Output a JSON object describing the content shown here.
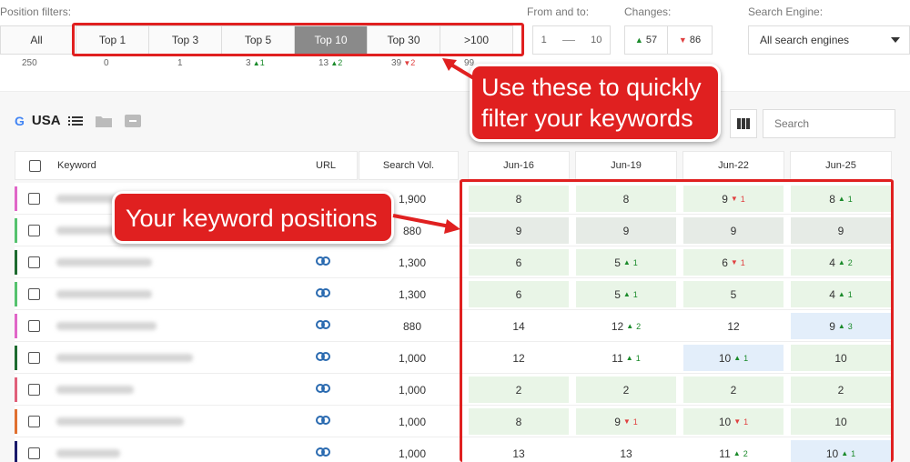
{
  "filters": {
    "position_label": "Position filters:",
    "all_label": "All",
    "buttons": [
      "Top 1",
      "Top 3",
      "Top 5",
      "Top 10",
      "Top 30",
      ">100"
    ],
    "active": "Top 10",
    "counts": [
      {
        "value": "250"
      },
      {
        "value": "0"
      },
      {
        "value": "1"
      },
      {
        "value": "3",
        "delta": "1",
        "dir": "up"
      },
      {
        "value": "13",
        "delta": "2",
        "dir": "up"
      },
      {
        "value": "39",
        "delta": "2",
        "dir": "down"
      },
      {
        "value": "99"
      }
    ],
    "from_to_label": "From and to:",
    "from_value": "1",
    "to_value": "10",
    "changes_label": "Changes:",
    "changes_up": "57",
    "changes_down": "86",
    "engine_label": "Search Engine:",
    "engine_value": "All search engines"
  },
  "panel": {
    "country": "USA",
    "search_placeholder": "Search"
  },
  "table": {
    "headers": {
      "keyword": "Keyword",
      "url": "URL",
      "volume": "Search Vol."
    },
    "dates": [
      "Jun-16",
      "Jun-19",
      "Jun-22",
      "Jun-25"
    ],
    "rows": [
      {
        "bar": "#e066c8",
        "link": false,
        "volume": "1,900",
        "kwlen": 80,
        "pos": [
          {
            "v": "8",
            "bg": "green"
          },
          {
            "v": "8",
            "bg": "green"
          },
          {
            "v": "9",
            "d": "1",
            "dir": "down",
            "bg": "green"
          },
          {
            "v": "8",
            "d": "1",
            "dir": "up",
            "bg": "green"
          }
        ]
      },
      {
        "bar": "#55c26e",
        "link": false,
        "volume": "880",
        "kwlen": 70,
        "pos": [
          {
            "v": "9",
            "bg": "grey"
          },
          {
            "v": "9",
            "bg": "grey"
          },
          {
            "v": "9",
            "bg": "grey"
          },
          {
            "v": "9",
            "bg": "grey"
          }
        ]
      },
      {
        "bar": "#1e6b30",
        "link": true,
        "volume": "1,300",
        "kwlen": 105,
        "pos": [
          {
            "v": "6",
            "bg": "green"
          },
          {
            "v": "5",
            "d": "1",
            "dir": "up",
            "bg": "green"
          },
          {
            "v": "6",
            "d": "1",
            "dir": "down",
            "bg": "green"
          },
          {
            "v": "4",
            "d": "2",
            "dir": "up",
            "bg": "green"
          }
        ]
      },
      {
        "bar": "#55c26e",
        "link": true,
        "volume": "1,300",
        "kwlen": 105,
        "pos": [
          {
            "v": "6",
            "bg": "green"
          },
          {
            "v": "5",
            "d": "1",
            "dir": "up",
            "bg": "green"
          },
          {
            "v": "5",
            "bg": "green"
          },
          {
            "v": "4",
            "d": "1",
            "dir": "up",
            "bg": "green"
          }
        ]
      },
      {
        "bar": "#e066c8",
        "link": true,
        "volume": "880",
        "kwlen": 110,
        "pos": [
          {
            "v": "14",
            "bg": "none"
          },
          {
            "v": "12",
            "d": "2",
            "dir": "up",
            "bg": "none"
          },
          {
            "v": "12",
            "bg": "none"
          },
          {
            "v": "9",
            "d": "3",
            "dir": "up",
            "bg": "blue"
          }
        ]
      },
      {
        "bar": "#1e6b30",
        "link": true,
        "volume": "1,000",
        "kwlen": 150,
        "pos": [
          {
            "v": "12",
            "bg": "none"
          },
          {
            "v": "11",
            "d": "1",
            "dir": "up",
            "bg": "none"
          },
          {
            "v": "10",
            "d": "1",
            "dir": "up",
            "bg": "blue"
          },
          {
            "v": "10",
            "bg": "green"
          }
        ]
      },
      {
        "bar": "#e0607a",
        "link": true,
        "volume": "1,000",
        "kwlen": 85,
        "pos": [
          {
            "v": "2",
            "bg": "green"
          },
          {
            "v": "2",
            "bg": "green"
          },
          {
            "v": "2",
            "bg": "green"
          },
          {
            "v": "2",
            "bg": "green"
          }
        ]
      },
      {
        "bar": "#e07030",
        "link": true,
        "volume": "1,000",
        "kwlen": 140,
        "pos": [
          {
            "v": "8",
            "bg": "green"
          },
          {
            "v": "9",
            "d": "1",
            "dir": "down",
            "bg": "green"
          },
          {
            "v": "10",
            "d": "1",
            "dir": "down",
            "bg": "green"
          },
          {
            "v": "10",
            "bg": "green"
          }
        ]
      },
      {
        "bar": "#1a1a6a",
        "link": true,
        "volume": "1,000",
        "kwlen": 70,
        "pos": [
          {
            "v": "13",
            "bg": "none"
          },
          {
            "v": "13",
            "bg": "none"
          },
          {
            "v": "11",
            "d": "2",
            "dir": "up",
            "bg": "none"
          },
          {
            "v": "10",
            "d": "1",
            "dir": "up",
            "bg": "blue"
          }
        ]
      }
    ]
  },
  "annotations": {
    "filter_callout_line1": "Use these to quickly",
    "filter_callout_line2": "filter your keywords",
    "positions_callout": "Your keyword positions",
    "color": "#e02020"
  }
}
